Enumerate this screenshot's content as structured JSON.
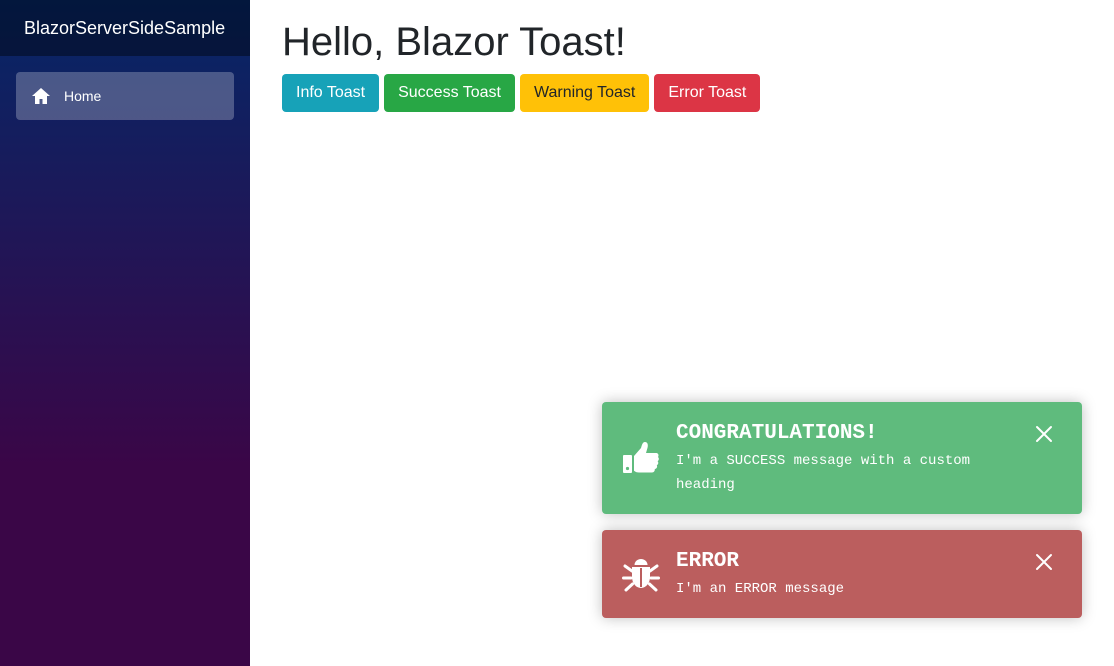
{
  "sidebar": {
    "brand": "BlazorServerSideSample",
    "items": [
      {
        "label": "Home",
        "icon": "home-icon"
      }
    ]
  },
  "main": {
    "title": "Hello, Blazor Toast!",
    "buttons": [
      {
        "label": "Info Toast",
        "color": "#17a2b8"
      },
      {
        "label": "Success Toast",
        "color": "#28a745"
      },
      {
        "label": "Warning Toast",
        "color": "#ffc107"
      },
      {
        "label": "Error Toast",
        "color": "#dc3545"
      }
    ]
  },
  "toasts": [
    {
      "type": "success",
      "icon": "thumbs-up-icon",
      "heading": "CONGRATULATIONS!",
      "message": "I'm a SUCCESS message with a custom heading",
      "color": "#5fbb7d"
    },
    {
      "type": "error",
      "icon": "bug-icon",
      "heading": "ERROR",
      "message": "I'm an ERROR message",
      "color": "#bb5e5e"
    }
  ]
}
